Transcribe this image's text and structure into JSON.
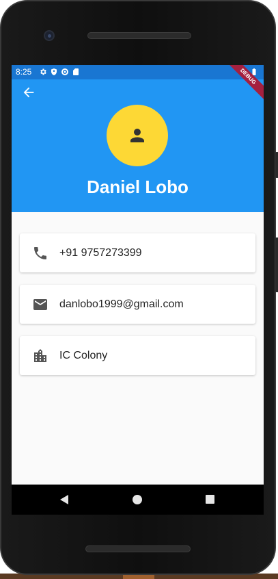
{
  "status_bar": {
    "time": "8:25",
    "left_icons": [
      "settings-icon",
      "shield-icon",
      "vpn-icon",
      "sd-card-icon"
    ],
    "right_icons": [
      "wifi-icon",
      "battery-icon"
    ]
  },
  "debug_banner": "DEBUG",
  "header": {
    "name": "Daniel Lobo",
    "back_icon": "arrow-back-icon",
    "avatar_icon": "person-icon",
    "bg_color": "#2196f3",
    "avatar_color": "#fdd835"
  },
  "details": [
    {
      "icon": "phone-icon",
      "text": "+91 9757273399"
    },
    {
      "icon": "email-icon",
      "text": "danlobo1999@gmail.com"
    },
    {
      "icon": "location-city-icon",
      "text": "IC Colony"
    }
  ],
  "nav_bar": {
    "icons": [
      "nav-back-icon",
      "nav-home-icon",
      "nav-recents-icon"
    ]
  }
}
